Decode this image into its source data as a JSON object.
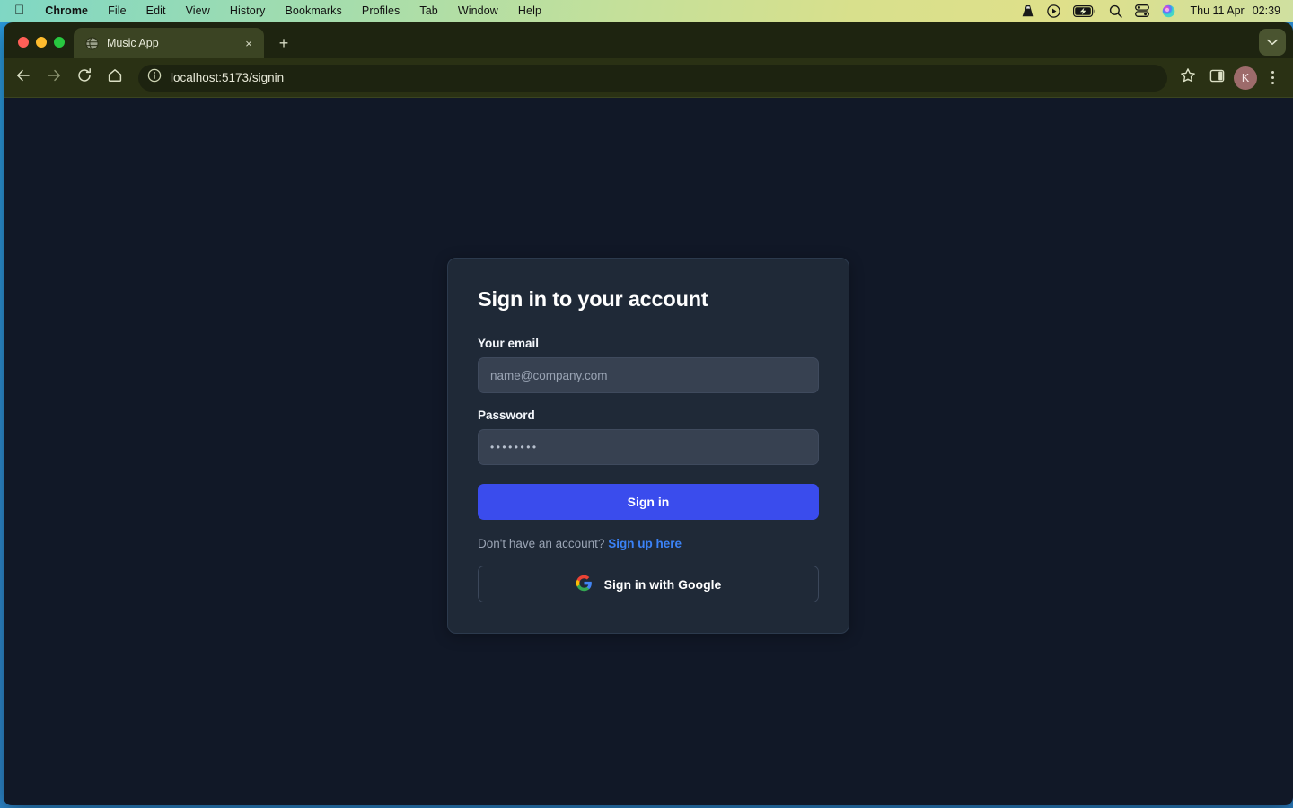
{
  "menubar": {
    "apple_icon": "apple-logo-icon",
    "items": [
      {
        "label": "Chrome",
        "bold": true
      },
      {
        "label": "File",
        "bold": false
      },
      {
        "label": "Edit",
        "bold": false
      },
      {
        "label": "View",
        "bold": false
      },
      {
        "label": "History",
        "bold": false
      },
      {
        "label": "Bookmarks",
        "bold": false
      },
      {
        "label": "Profiles",
        "bold": false
      },
      {
        "label": "Tab",
        "bold": false
      },
      {
        "label": "Window",
        "bold": false
      },
      {
        "label": "Help",
        "bold": false
      }
    ],
    "status_icons": [
      "vlc-cone-icon",
      "play-circle-icon",
      "battery-charging-icon",
      "search-icon",
      "control-center-icon",
      "siri-icon"
    ],
    "day": "Thu 11 Apr",
    "time": "02:39"
  },
  "browser": {
    "tab": {
      "favicon": "globe-icon",
      "title": "Music App",
      "close_label": "×"
    },
    "new_tab_label": "+",
    "tablist_icon": "chevron-down-icon",
    "nav": {
      "back_icon": "back-arrow-icon",
      "forward_icon": "forward-arrow-icon",
      "reload_icon": "reload-icon",
      "home_icon": "home-icon"
    },
    "omnibox": {
      "info_icon": "info-circle-icon",
      "url": "localhost:5173/signin"
    },
    "bookmark_icon": "star-icon",
    "side_panel_icon": "side-panel-icon",
    "profile_initial": "K",
    "menu_icon": "three-dots-icon"
  },
  "page": {
    "title": "Sign in to your account",
    "email": {
      "label": "Your email",
      "placeholder": "name@company.com",
      "value": ""
    },
    "password": {
      "label": "Password",
      "value": "••••••••"
    },
    "signin_button": "Sign in",
    "signup_prompt": "Don't have an account?",
    "signup_link": "Sign up here",
    "google_button": "Sign in with Google",
    "google_icon": "google-g-icon",
    "colors": {
      "page_bg": "#111827",
      "card_bg": "#1f2937",
      "input_bg": "#374151",
      "primary": "#3a4ced",
      "link": "#3b82f6"
    }
  }
}
